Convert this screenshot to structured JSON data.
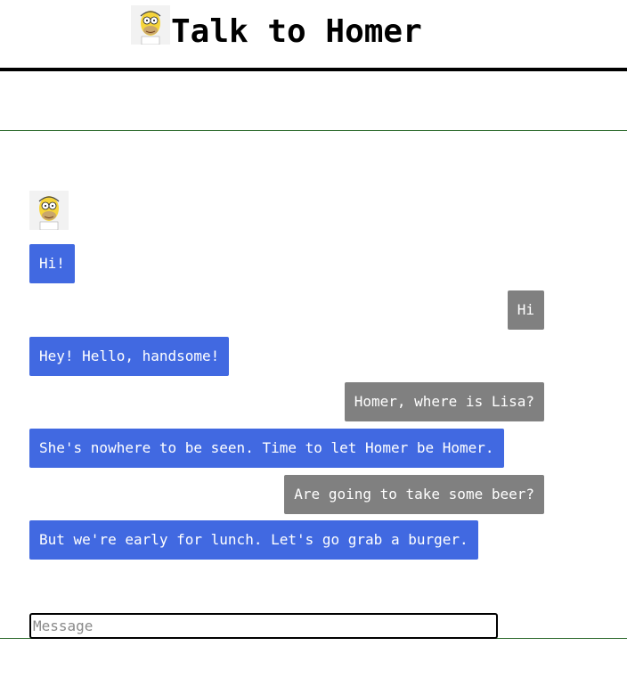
{
  "header": {
    "title": "Talk to Homer",
    "avatar_icon": "homer-face-icon"
  },
  "chat": {
    "avatar_icon": "homer-face-icon",
    "messages": [
      {
        "from": "homer",
        "text": "Hi!"
      },
      {
        "from": "user",
        "text": "Hi"
      },
      {
        "from": "homer",
        "text": "Hey! Hello, handsome!"
      },
      {
        "from": "user",
        "text": "Homer, where is Lisa?"
      },
      {
        "from": "homer",
        "text": "She's nowhere to be seen. Time to let Homer be Homer."
      },
      {
        "from": "user",
        "text": "Are going to take some beer?"
      },
      {
        "from": "homer",
        "text": "But we're early for lunch. Let's go grab a burger."
      }
    ]
  },
  "input": {
    "placeholder": "Message",
    "value": ""
  },
  "colors": {
    "homer_bubble": "#4169e1",
    "user_bubble": "#808080",
    "divider": "#2e6b2e"
  }
}
